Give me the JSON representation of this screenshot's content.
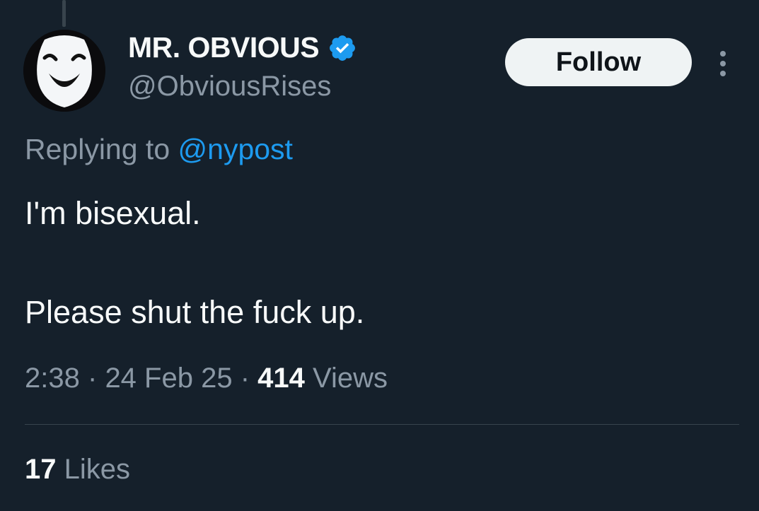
{
  "author": {
    "display_name": "MR. OBVIOUS",
    "handle": "@ObviousRises",
    "verified": true,
    "avatar_icon": "white-smiling-mask-avatar"
  },
  "follow_button": {
    "label": "Follow"
  },
  "more_menu": {
    "icon": "more-vertical-icon"
  },
  "reply": {
    "prefix": "Replying to",
    "mention": "@nypost"
  },
  "tweet": {
    "paragraphs": [
      "I'm bisexual.",
      "Please shut the fuck up."
    ]
  },
  "meta": {
    "time": "2:38",
    "separator": "·",
    "date": "24 Feb 25",
    "views_count": "414",
    "views_label": "Views"
  },
  "engagement": {
    "likes_count": "17",
    "likes_label": "Likes"
  },
  "colors": {
    "background": "#15202b",
    "primary_text": "#f7f9f9",
    "secondary_text": "#8b98a5",
    "accent": "#1d9bf0",
    "divider": "#38444d",
    "follow_button_bg": "#eff3f4"
  }
}
